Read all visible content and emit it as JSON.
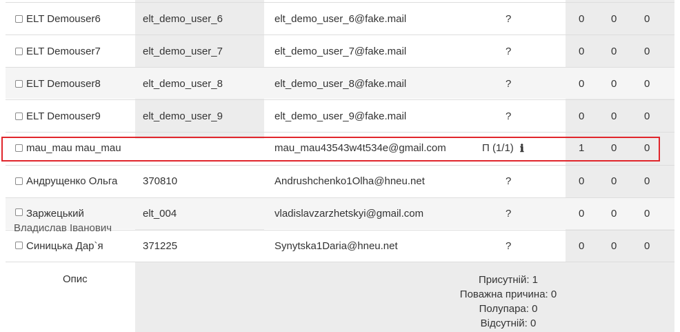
{
  "rows": [
    {
      "name": "ELT Demouser6",
      "username": "elt_demo_user_6",
      "email": "elt_demo_user_6@fake.mail",
      "status": "?",
      "c1": "0",
      "c2": "0",
      "c3": "0"
    },
    {
      "name": "ELT Demouser7",
      "username": "elt_demo_user_7",
      "email": "elt_demo_user_7@fake.mail",
      "status": "?",
      "c1": "0",
      "c2": "0",
      "c3": "0"
    },
    {
      "name": "ELT Demouser8",
      "username": "elt_demo_user_8",
      "email": "elt_demo_user_8@fake.mail",
      "status": "?",
      "c1": "0",
      "c2": "0",
      "c3": "0"
    },
    {
      "name": "ELT Demouser9",
      "username": "elt_demo_user_9",
      "email": "elt_demo_user_9@fake.mail",
      "status": "?",
      "c1": "0",
      "c2": "0",
      "c3": "0"
    },
    {
      "name": "mau_mau mau_mau",
      "username": "",
      "email": "mau_mau43543w4t534e@gmail.com",
      "status": "П (1/1)",
      "c1": "1",
      "c2": "0",
      "c3": "0",
      "info_icon": "info-icon"
    },
    {
      "name": "Андрущенко Ольга",
      "username": "370810",
      "email": "Andrushchenko1Olha@hneu.net",
      "status": "?",
      "c1": "0",
      "c2": "0",
      "c3": "0"
    },
    {
      "name": "Заржецький",
      "name_line2": "Владислав Іванович",
      "username": "elt_004",
      "email": "vladislavzarzhetskyi@gmail.com",
      "status": "?",
      "c1": "0",
      "c2": "0",
      "c3": "0"
    },
    {
      "name": "Синицька Дар`я",
      "username": "371225",
      "email": "Synytska1Daria@hneu.net",
      "status": "?",
      "c1": "0",
      "c2": "0",
      "c3": "0"
    }
  ],
  "footer": {
    "description_label": "Опис",
    "summary": [
      "Присутній: 1",
      "Поважна причина: 0",
      "Полупара: 0",
      "Відсутній: 0"
    ]
  },
  "colors": {
    "highlight_border": "#e0252b",
    "column_background": "#ececec",
    "alt_row_background": "#f5f5f5"
  }
}
